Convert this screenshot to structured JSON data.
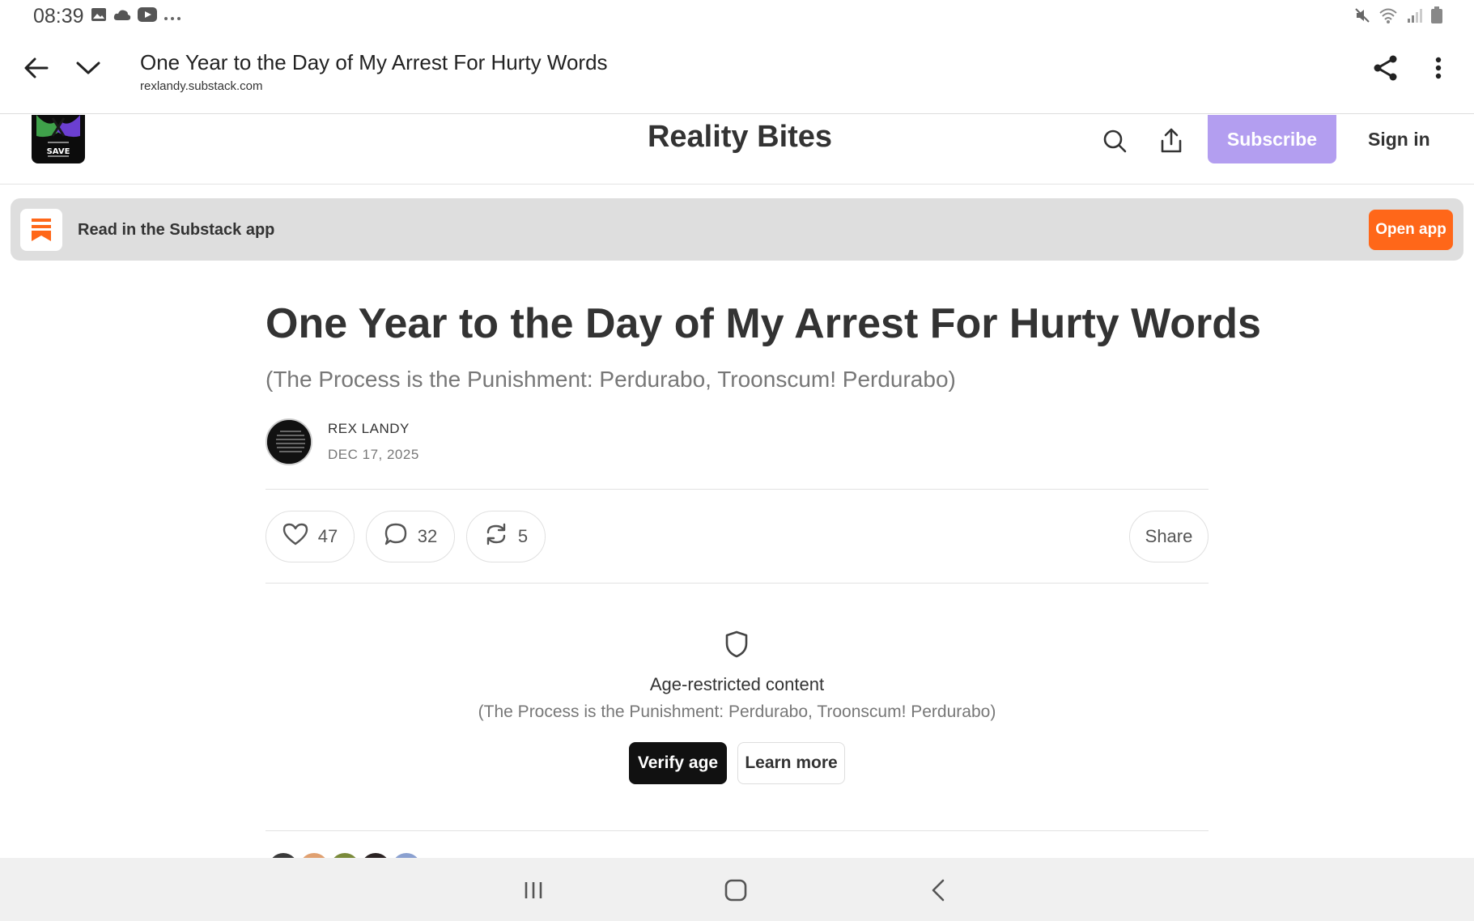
{
  "status_bar": {
    "time": "08:39",
    "left_icons": [
      "image-icon",
      "cloud-icon",
      "youtube-icon",
      "more-dots-icon"
    ],
    "right_icons": [
      "mute-icon",
      "wifi-icon",
      "signal-icon",
      "battery-icon"
    ]
  },
  "browser": {
    "page_title": "One Year to the Day of My Arrest For Hurty Words",
    "url": "rexlandy.substack.com",
    "icons": [
      "back-arrow-icon",
      "chevron-down-icon",
      "share-icon",
      "more-vertical-icon"
    ]
  },
  "site_header": {
    "name": "Reality Bites",
    "logo_text": "SAVE",
    "subscribe_label": "Subscribe",
    "signin_label": "Sign in",
    "icons": [
      "search-icon",
      "upload-share-icon"
    ]
  },
  "app_banner": {
    "text": "Read in the Substack app",
    "button_label": "Open app",
    "icon": "substack-logo-icon"
  },
  "article": {
    "title": "One Year to the Day of My Arrest For Hurty Words",
    "subtitle": "(The Process is the Punishment: Perdurabo, Troonscum! Perdurabo)",
    "author": "REX LANDY",
    "date": "DEC 17, 2025"
  },
  "actions": {
    "likes": "47",
    "comments": "32",
    "restacks": "5",
    "share_label": "Share"
  },
  "restricted": {
    "title": "Age-restricted content",
    "subtitle": "(The Process is the Punishment: Perdurabo, Troonscum! Perdurabo)",
    "verify_label": "Verify age",
    "learn_label": "Learn more"
  },
  "colors": {
    "subscribe": "#b39ef0",
    "open_app": "#ff6719",
    "verify": "#111111"
  },
  "system_nav": [
    "recents-icon",
    "home-icon",
    "back-icon"
  ]
}
